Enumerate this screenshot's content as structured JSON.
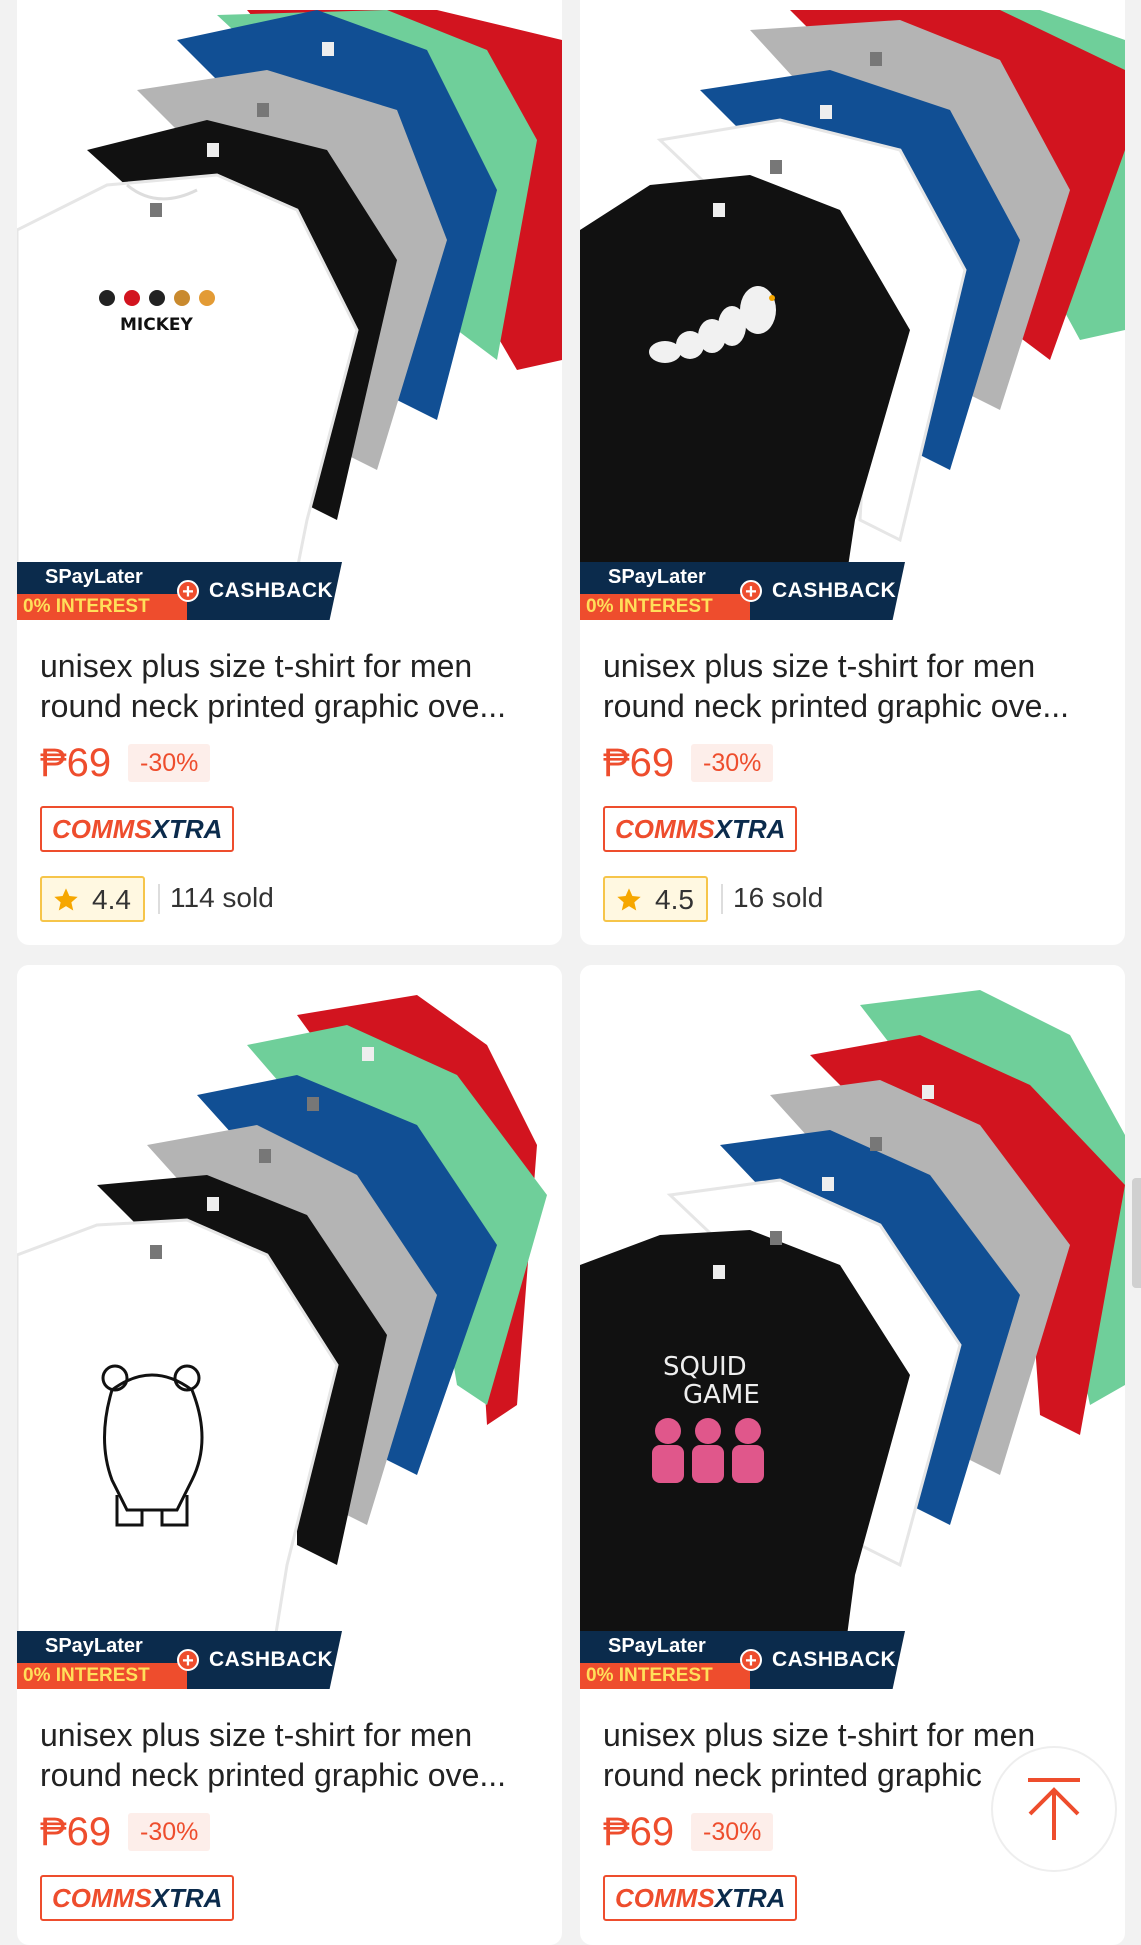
{
  "products": [
    {
      "image_desc_icon": "tshirt-stack-mickey-icon",
      "badge": {
        "spaylater": "SPayLater",
        "interest": "0% INTEREST",
        "cashback": "CASHBACK"
      },
      "title_line1": "unisex plus size t-shirt for men",
      "title_line2": "round neck printed graphic ove...",
      "price": "₱69",
      "discount": "-30%",
      "voucher_part1": "COMMS",
      "voucher_part2": "XTRA",
      "rating": "4.4",
      "sold": "114 sold",
      "print_text": "MICKEY"
    },
    {
      "image_desc_icon": "tshirt-stack-cute-blobs-icon",
      "badge": {
        "spaylater": "SPayLater",
        "interest": "0% INTEREST",
        "cashback": "CASHBACK"
      },
      "title_line1": "unisex plus size t-shirt for men",
      "title_line2": "round neck printed graphic ove...",
      "price": "₱69",
      "discount": "-30%",
      "voucher_part1": "COMMS",
      "voucher_part2": "XTRA",
      "rating": "4.5",
      "sold": "16 sold"
    },
    {
      "image_desc_icon": "tshirt-stack-bear-icon",
      "badge": {
        "spaylater": "SPayLater",
        "interest": "0% INTEREST",
        "cashback": "CASHBACK"
      },
      "title_line1": "unisex plus size t-shirt for men",
      "title_line2": "round neck printed graphic ove...",
      "price": "₱69",
      "discount": "-30%",
      "voucher_part1": "COMMS",
      "voucher_part2": "XTRA"
    },
    {
      "image_desc_icon": "tshirt-stack-squid-game-icon",
      "badge": {
        "spaylater": "SPayLater",
        "interest": "0% INTEREST",
        "cashback": "CASHBACK"
      },
      "title_line1": "unisex plus size t-shirt for men",
      "title_line2": "round neck printed graphic",
      "price": "₱69",
      "discount": "-30%",
      "voucher_part1": "COMMS",
      "voucher_part2": "XTRA",
      "print_text_1": "SQUID",
      "print_text_2": "GAME"
    }
  ],
  "scroll_top_icon": "arrow-up-to-top-icon",
  "colors": {
    "brand_orange": "#ee4d2d",
    "navy": "#0b2b4c",
    "shirt_red": "#d2141f",
    "shirt_green": "#6fcf9a",
    "shirt_blue": "#114f94",
    "shirt_grey": "#b4b4b4",
    "shirt_black": "#111111"
  }
}
